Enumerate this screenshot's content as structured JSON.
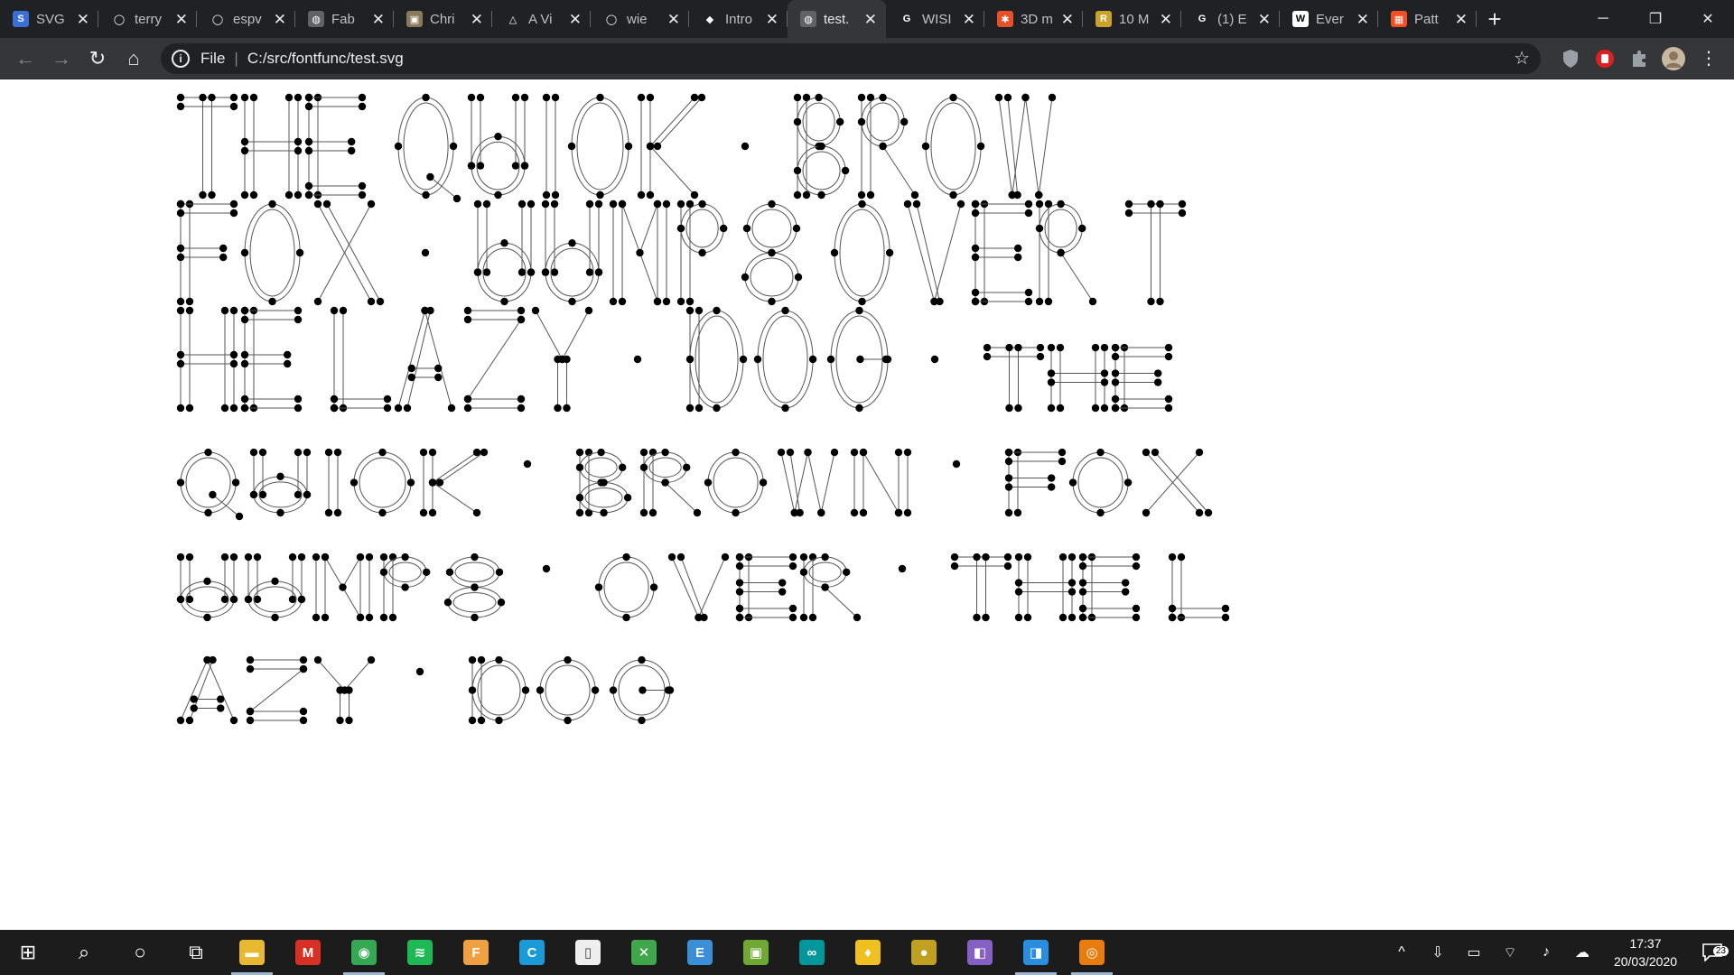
{
  "tabs": [
    {
      "title": "SVG",
      "icon": "svg-icon",
      "color": "#3b6fd6",
      "glyph": "S"
    },
    {
      "title": "terry",
      "icon": "github-icon",
      "color": "#202124",
      "glyph": "◯"
    },
    {
      "title": "espv",
      "icon": "github-icon",
      "color": "#202124",
      "glyph": "◯"
    },
    {
      "title": "Fab",
      "icon": "globe-icon",
      "color": "#5f6368",
      "glyph": "◍"
    },
    {
      "title": "Chri",
      "icon": "image-icon",
      "color": "#8a7a5a",
      "glyph": "▣"
    },
    {
      "title": "A Vi",
      "icon": "archive-icon",
      "color": "#202124",
      "glyph": "△"
    },
    {
      "title": "wie",
      "icon": "github-icon",
      "color": "#202124",
      "glyph": "◯"
    },
    {
      "title": "Intro",
      "icon": "graduation-cap-icon",
      "color": "#202124",
      "glyph": "◆"
    },
    {
      "title": "test.",
      "icon": "globe-icon",
      "color": "#5f6368",
      "glyph": "◍",
      "active": true
    },
    {
      "title": "WISI",
      "icon": "g-icon",
      "color": "#202124",
      "glyph": "G"
    },
    {
      "title": "3D m",
      "icon": "blender-icon",
      "color": "#e8502a",
      "glyph": "✱"
    },
    {
      "title": "10 M",
      "icon": "sr-icon",
      "color": "#c9a227",
      "glyph": "R"
    },
    {
      "title": "(1) E",
      "icon": "g-icon",
      "color": "#202124",
      "glyph": "G"
    },
    {
      "title": "Ever",
      "icon": "wikipedia-icon",
      "color": "#ffffff",
      "glyph": "W"
    },
    {
      "title": "Patt",
      "icon": "microsoft-icon",
      "color": "#f25022",
      "glyph": "▦"
    }
  ],
  "newtab_label": "+",
  "window": {
    "minimize": "─",
    "maximize": "❐",
    "close": "✕"
  },
  "toolbar": {
    "back": "←",
    "forward": "→",
    "reload": "↻",
    "home": "⌂",
    "scheme_label": "File",
    "separator": "|",
    "url": "C:/src/fontfunc/test.svg",
    "info_glyph": "i",
    "star": "☆"
  },
  "document": {
    "type": "svg-font-test",
    "text_lines": [
      "THE QUICK · BROW",
      "FOX · JUMPS OVER T",
      "HE LAZY · DOG · the",
      "quick · brown · fox",
      "jumps · over · the l",
      "azy · dog"
    ],
    "stroke_color": "#555555",
    "dot_color": "#000000"
  },
  "taskbar": {
    "apps": [
      {
        "name": "start-button",
        "glyph": "⊞",
        "color": "transparent"
      },
      {
        "name": "search-icon",
        "glyph": "⌕",
        "color": "transparent"
      },
      {
        "name": "cortana-icon",
        "glyph": "○",
        "color": "transparent"
      },
      {
        "name": "task-view-icon",
        "glyph": "⧉",
        "color": "transparent"
      },
      {
        "name": "file-explorer-icon",
        "glyph": "▬",
        "color": "#e8b830",
        "running": true
      },
      {
        "name": "gmail-icon",
        "glyph": "M",
        "color": "#d93025"
      },
      {
        "name": "chrome-icon",
        "glyph": "◉",
        "color": "#34a853",
        "running": true
      },
      {
        "name": "spotify-icon",
        "glyph": "≋",
        "color": "#1db954"
      },
      {
        "name": "fontforge-icon",
        "glyph": "F",
        "color": "#f0a040"
      },
      {
        "name": "cclean-icon",
        "glyph": "C",
        "color": "#1a9ad6"
      },
      {
        "name": "notepad-icon",
        "glyph": "▯",
        "color": "#eeeeee"
      },
      {
        "name": "inkscape-icon",
        "glyph": "✕",
        "color": "#3fa64b"
      },
      {
        "name": "terminal-icon",
        "glyph": "E",
        "color": "#3b8fd6"
      },
      {
        "name": "image-viewer-icon",
        "glyph": "▣",
        "color": "#6fa832"
      },
      {
        "name": "arduino-icon",
        "glyph": "∞",
        "color": "#00979c"
      },
      {
        "name": "bulb-icon",
        "glyph": "♦",
        "color": "#f0c020"
      },
      {
        "name": "planet-icon",
        "glyph": "●",
        "color": "#c0a020"
      },
      {
        "name": "visual-studio-icon",
        "glyph": "◧",
        "color": "#8661c5"
      },
      {
        "name": "vscode-icon",
        "glyph": "◨",
        "color": "#2a8ee0",
        "running": true
      },
      {
        "name": "blender-icon",
        "glyph": "◎",
        "color": "#e87d0d",
        "running": true
      }
    ],
    "tray": [
      "^",
      "⇩",
      "▭",
      "⌔",
      "♪",
      "☁"
    ],
    "time": "17:37",
    "date": "20/03/2020",
    "notifications": "23"
  }
}
